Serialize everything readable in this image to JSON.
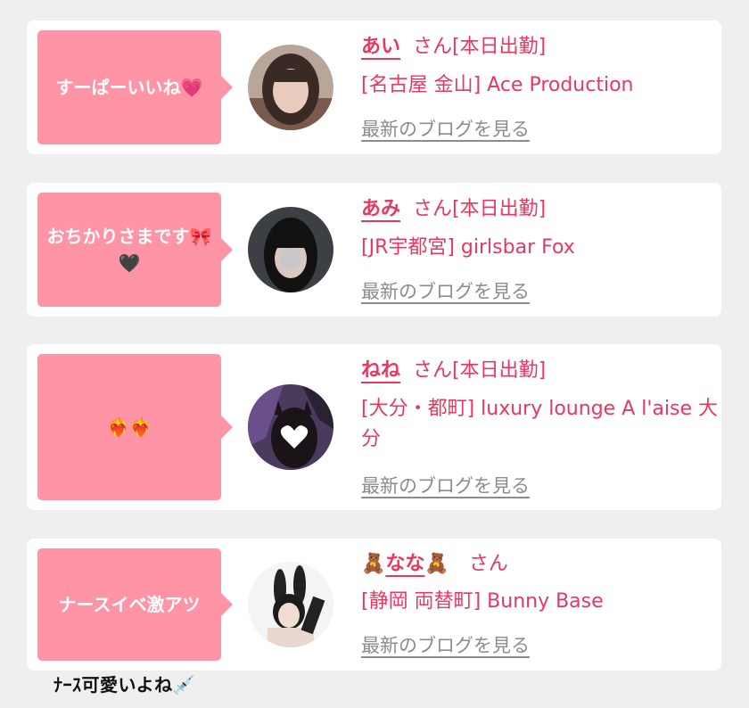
{
  "colors": {
    "accent": "#e8385f",
    "bubble": "#ff94a6",
    "link_gray": "#8c8c8c"
  },
  "cards": [
    {
      "message": "すーぱーいいね💗",
      "name": "あい",
      "suffix": "さん[本日出勤]",
      "store": "[名古屋 金山] Ace Production",
      "blog_link": "最新のブログを見る"
    },
    {
      "message": "おちかりさまです🎀🖤",
      "name": "あみ",
      "suffix": "さん[本日出勤]",
      "store": "[JR宇都宮] girlsbar Fox",
      "blog_link": "最新のブログを見る"
    },
    {
      "message": "❤️‍🔥❤️‍🔥",
      "name": "ねね",
      "suffix": "さん[本日出勤]",
      "store": "[大分・都町] luxury lounge A l'aise 大分",
      "blog_link": "最新のブログを見る"
    },
    {
      "message": "ナースイベ激アツ",
      "name_prefix": "🧸",
      "name": "なな",
      "name_suffix_icon": "🧸",
      "suffix": "さん",
      "store": "[静岡 両替町] Bunny Base",
      "blog_link": "最新のブログを見る"
    }
  ],
  "caption": "ﾅｰｽ可愛いよね💉"
}
